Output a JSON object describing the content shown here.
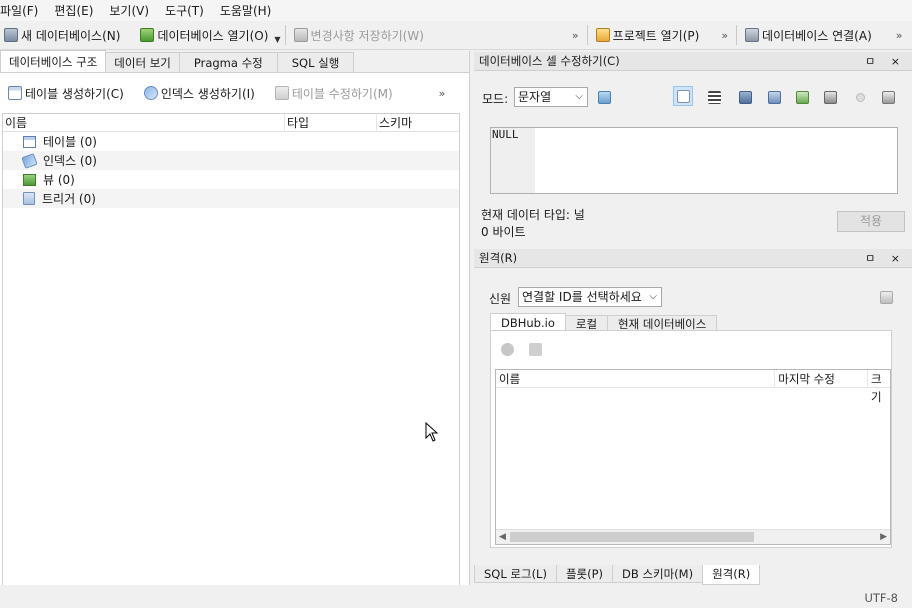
{
  "menu": [
    "파일(F)",
    "편집(E)",
    "보기(V)",
    "도구(T)",
    "도움말(H)"
  ],
  "toolbar": {
    "new_db": "새 데이터베이스(N)",
    "open_db": "데이터베이스 열기(O)",
    "save_changes": "변경사항 저장하기(W)",
    "open_project": "프로젝트 열기(P)",
    "connect_db": "데이터베이스 연결(A)",
    "overflow": "»"
  },
  "left": {
    "tabs": [
      "데이터베이스 구조",
      "데이터 보기",
      "Pragma 수정",
      "SQL 실행"
    ],
    "actions": {
      "create_table": "테이블 생성하기(C)",
      "create_index": "인덱스 생성하기(I)",
      "modify_table": "테이블 수정하기(M)",
      "overflow": "»"
    },
    "columns": [
      "이름",
      "타입",
      "스키마"
    ],
    "tree": [
      {
        "label": "테이블 (0)",
        "icon": "table-icon"
      },
      {
        "label": "인덱스 (0)",
        "icon": "index-icon"
      },
      {
        "label": "뷰 (0)",
        "icon": "view-icon"
      },
      {
        "label": "트리거 (0)",
        "icon": "trigger-icon"
      }
    ]
  },
  "cell_editor": {
    "title": "데이터베이스 셀 수정하기(C)",
    "mode_label": "모드:",
    "mode_value": "문자열",
    "content": "NULL",
    "type_info": "현재 데이터 타입: 널",
    "size_info": "0 바이트",
    "apply": "적용"
  },
  "remote": {
    "title": "원격(R)",
    "identity_label": "신원",
    "identity_placeholder": "연결할 ID를 선택하세요",
    "tabs": [
      "DBHub.io",
      "로컬",
      "현재 데이터베이스"
    ],
    "columns": [
      "이름",
      "마지막 수정",
      "크기"
    ]
  },
  "bottom_tabs": [
    "SQL 로그(L)",
    "플롯(P)",
    "DB 스키마(M)",
    "원격(R)"
  ],
  "status": {
    "encoding": "UTF-8"
  },
  "panel_controls": "ㅁ ×"
}
